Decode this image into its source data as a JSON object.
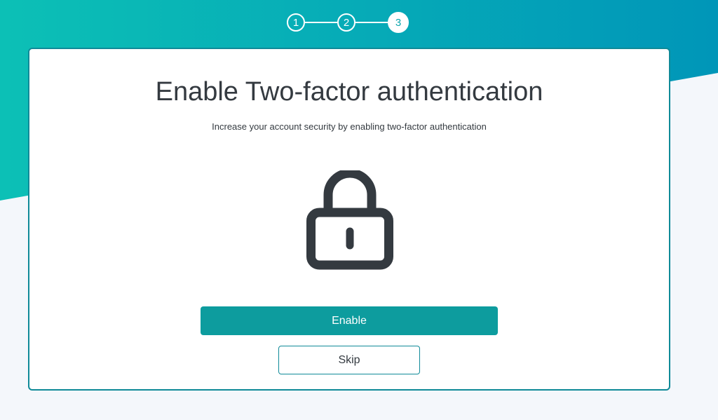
{
  "stepper": {
    "steps": [
      {
        "label": "1",
        "state": "completed"
      },
      {
        "label": "2",
        "state": "completed"
      },
      {
        "label": "3",
        "state": "active"
      }
    ]
  },
  "card": {
    "title": "Enable Two-factor authentication",
    "subtitle": "Increase your account security by enabling two-factor authentication",
    "icon": "lock-icon"
  },
  "actions": {
    "enable_label": "Enable",
    "skip_label": "Skip"
  },
  "colors": {
    "gradient_start": "#0cc0b6",
    "gradient_end": "#0096b8",
    "primary": "#0d9c9e",
    "card_border": "#0f8a98",
    "text": "#343a40",
    "background": "#f4f7fb"
  }
}
